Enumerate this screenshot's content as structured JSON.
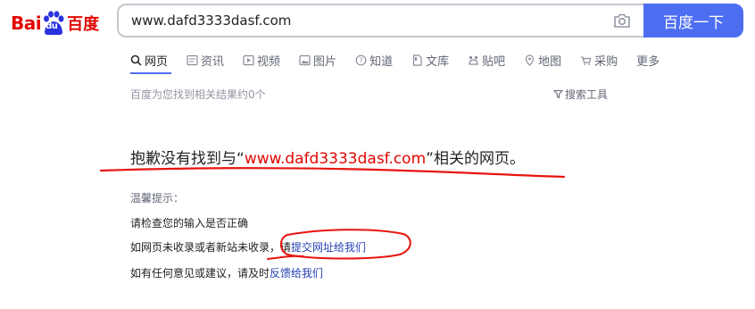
{
  "logo": {
    "bai": "Bai",
    "du": "du",
    "cn": "百度"
  },
  "search": {
    "value": "www.dafd3333dasf.com",
    "button_label": "百度一下"
  },
  "tabs": [
    {
      "label": "网页",
      "icon": "search-icon"
    },
    {
      "label": "资讯",
      "icon": "news-icon"
    },
    {
      "label": "视频",
      "icon": "video-icon"
    },
    {
      "label": "图片",
      "icon": "image-icon"
    },
    {
      "label": "知道",
      "icon": "question-icon"
    },
    {
      "label": "文库",
      "icon": "document-icon"
    },
    {
      "label": "贴吧",
      "icon": "forum-icon"
    },
    {
      "label": "地图",
      "icon": "map-icon"
    },
    {
      "label": "采购",
      "icon": "cart-icon"
    },
    {
      "label": "更多",
      "icon": ""
    }
  ],
  "results": {
    "count_text": "百度为您找到相关结果约0个",
    "tools_label": "搜索工具"
  },
  "message": {
    "prefix": "抱歉没有找到与",
    "open_quote": "“",
    "query": "www.dafd3333dasf.com",
    "close_quote": "”",
    "suffix": "相关的网页。"
  },
  "tips": {
    "title": "温馨提示：",
    "line1": "请检查您的输入是否正确",
    "line2_text": "如网页未收录或者新站未收录，请",
    "line2_link": "提交网址给我们",
    "line3_text": "如有任何意见或建议，请及时",
    "line3_link": "反馈给我们"
  },
  "colors": {
    "brand_red": "#e10601",
    "brand_blue": "#4e6ef2",
    "link": "#2440b3",
    "annotation": "#e8140f"
  }
}
